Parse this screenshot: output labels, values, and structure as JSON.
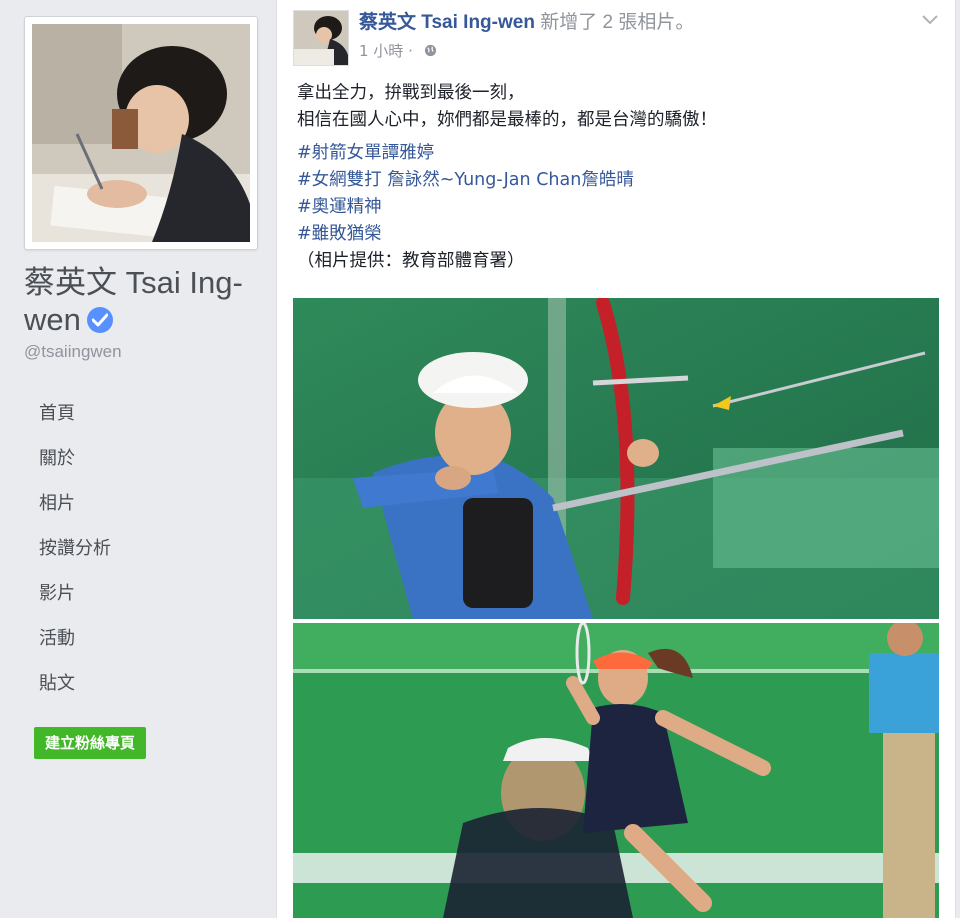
{
  "sidebar": {
    "page_name": "蔡英文 Tsai Ing-wen",
    "handle": "@tsaiingwen",
    "nav_items": [
      {
        "label": "首頁"
      },
      {
        "label": "關於"
      },
      {
        "label": "相片"
      },
      {
        "label": "按讚分析"
      },
      {
        "label": "影片"
      },
      {
        "label": "活動"
      },
      {
        "label": "貼文"
      }
    ],
    "create_page_label": "建立粉絲專頁"
  },
  "post": {
    "author": "蔡英文 Tsai Ing-wen",
    "action": "新增了 2 張相片。",
    "timestamp": "1 小時",
    "body_line1": "拿出全力，拚戰到最後一刻，",
    "body_line2": "相信在國人心中，妳們都是最棒的，都是台灣的驕傲！",
    "hashtags": [
      {
        "text": "#射箭女單譚雅婷"
      },
      {
        "text": "#女網雙打 詹詠然~Yung-Jan Chan詹皓晴"
      },
      {
        "text": "#奧運精神"
      },
      {
        "text": "#雖敗猶榮"
      }
    ],
    "credit": "（相片提供：教育部體育署）"
  },
  "colors": {
    "link": "#365899",
    "meta": "#90949c",
    "button": "#42b72a",
    "verified": "#5890ff"
  },
  "icons": [
    "verified-icon",
    "globe-icon",
    "chevron-down-icon"
  ]
}
